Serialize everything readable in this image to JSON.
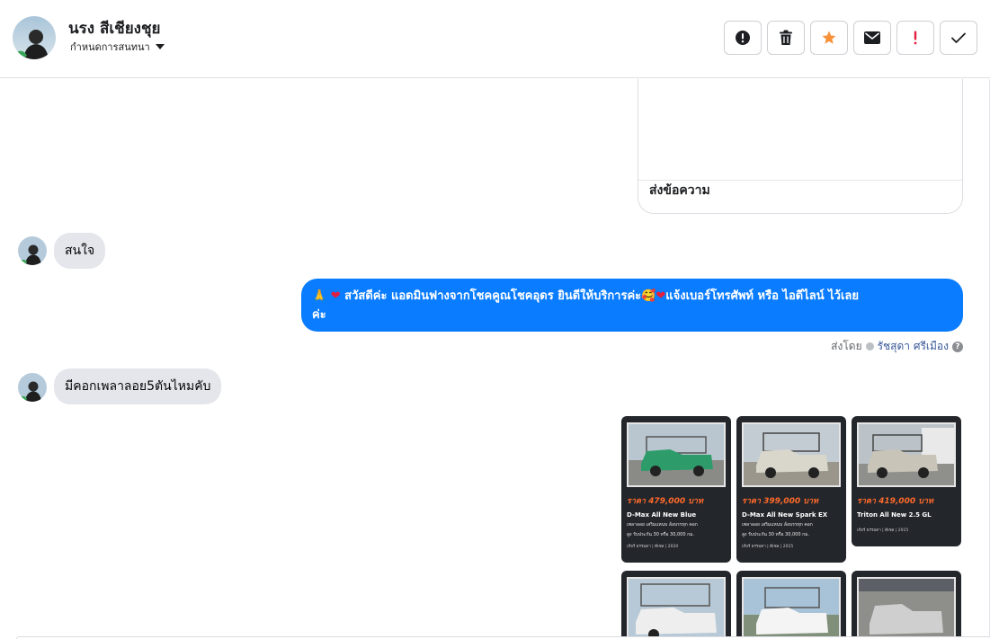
{
  "header": {
    "contact_name": "นรง สีเชียงชุย",
    "assign_label": "กำหนดการสนทนา",
    "actions": [
      {
        "name": "mark-spam",
        "icon": "alert-circle-icon"
      },
      {
        "name": "delete",
        "icon": "trash-icon"
      },
      {
        "name": "star",
        "icon": "star-icon",
        "color": "#f7923b"
      },
      {
        "name": "mark-unread",
        "icon": "envelope-icon"
      },
      {
        "name": "follow-up",
        "icon": "exclamation-icon",
        "color": "#e41e3f"
      },
      {
        "name": "mark-done",
        "icon": "check-icon"
      }
    ]
  },
  "thread": {
    "previous_card": {
      "button_label": "ส่งข้อความ"
    },
    "messages": [
      {
        "direction": "incoming",
        "text": "สนใจ"
      },
      {
        "direction": "outgoing",
        "line1": "สวัสดีค่ะ แอดมินฟางจากโชคคูณโชคอุดร ยินดีให้บริการค่ะ",
        "line1b": "แจ้งเบอร์โทรศัพท์ หรือ ไอดีไลน์  ไว้เลย",
        "line2": "ค่ะ",
        "emojis": [
          "folded-hands-icon",
          "heart-icon",
          "smiling-face-hearts-icon",
          "heart-icon"
        ]
      },
      {
        "direction": "incoming",
        "text": "มีคอกเพลาลอย5ตันไหมคับ"
      }
    ],
    "sent_by": {
      "prefix": "ส่งโดย",
      "name": "รัชสุดา ศรีเมือง"
    }
  },
  "listings": [
    {
      "price": "ราคา 479,000 บาท",
      "model": "D-Max All New Blue",
      "desc1": "เพลาลอย เสริมแหนบ ล้อบรรทุก คอก",
      "desc2": "สูง รับประกัน 30 หรือ 30,000 กม.",
      "meta": "เกียร์ ธรรมดา | ดีเซล | 2020",
      "photo_color": "#2e9c6a"
    },
    {
      "price": "ราคา 399,000 บาท",
      "model": "D-Max All New Spark EX",
      "desc1": "เพลาลอย เสริมแหนบ ล้อบรรทุก คอก",
      "desc2": "สูง รับประกัน 30 หรือ 30,000 กม.",
      "meta": "เกียร์ ธรรมดา | ดีเซล | 2015",
      "photo_color": "#d9d6cc"
    },
    {
      "price": "ราคา 419,000 บาท",
      "model": "Triton All New 2.5 GL",
      "desc1": "",
      "desc2": "",
      "meta": "เกียร์ ธรรมดา | ดีเซล | 2015",
      "photo_color": "#c8c4b8"
    },
    {
      "price": "",
      "model": "",
      "desc1": "",
      "desc2": "",
      "meta": "",
      "photo_color": "#e8e8e8"
    },
    {
      "price": "",
      "model": "",
      "desc1": "",
      "desc2": "",
      "meta": "",
      "photo_color": "#f0f0f0"
    },
    {
      "price": "",
      "model": "",
      "desc1": "",
      "desc2": "",
      "meta": "",
      "photo_color": "#cfcfcf"
    }
  ]
}
